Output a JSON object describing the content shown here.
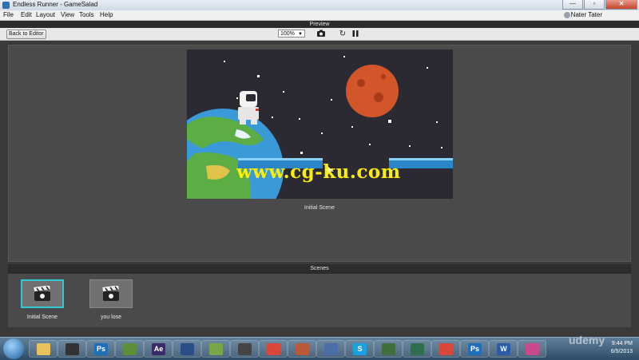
{
  "window": {
    "title": "Endless Runner - GameSalad",
    "min": "—",
    "max": "▫",
    "close": "✕"
  },
  "menu": {
    "items": [
      "File",
      "Edit",
      "Layout",
      "View",
      "Tools",
      "Help"
    ],
    "user": "Nater Tater"
  },
  "preview": {
    "header": "Preview",
    "back_button": "Back to Editor",
    "zoom": "100%",
    "icons": [
      "camera-icon",
      "restart-icon",
      "pause-icon"
    ]
  },
  "stage": {
    "caption": "Initial Scene"
  },
  "watermark": "www.cg-ku.com",
  "scenes": {
    "header": "Scenes",
    "items": [
      {
        "label": "Initial Scene",
        "selected": true
      },
      {
        "label": "you lose",
        "selected": false
      }
    ]
  },
  "taskbar": {
    "apps": [
      "explorer",
      "media",
      "photoshop",
      "minecraft",
      "after-effects",
      "cinema4d",
      "notepad",
      "unity",
      "chrome",
      "shield",
      "save",
      "skype",
      "tv",
      "monitor",
      "chrome",
      "photoshop",
      "word",
      "gamesalad"
    ],
    "time": "9:44 PM",
    "date": "6/5/2013",
    "brand": "udemy"
  },
  "colors": {
    "selection": "#34c8d2",
    "space": "#2b2a33",
    "planet": "#d2562a",
    "platform": "#2a86c8"
  }
}
